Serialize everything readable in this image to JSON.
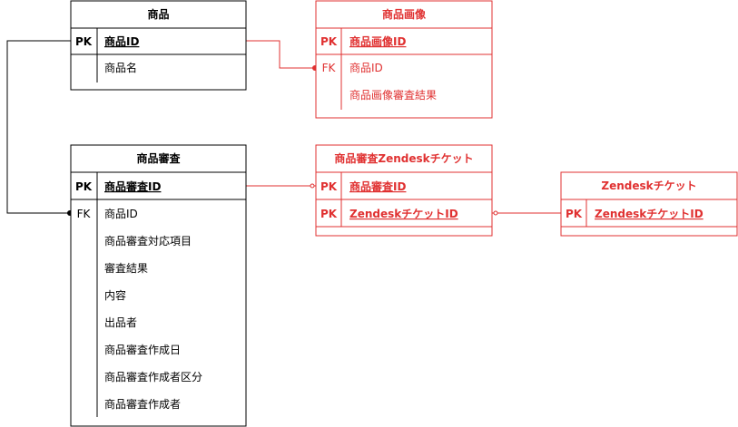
{
  "colors": {
    "black": "#000000",
    "red": "#e03131"
  },
  "entities": [
    {
      "id": "product",
      "title": "商品",
      "color": "#000000",
      "rows": [
        {
          "key": "PK",
          "name": "商品ID",
          "pk": true
        },
        {
          "key": "",
          "name": "商品名",
          "pk": false
        }
      ]
    },
    {
      "id": "product-image",
      "title": "商品画像",
      "color": "#e03131",
      "rows": [
        {
          "key": "PK",
          "name": "商品画像ID",
          "pk": true
        },
        {
          "key": "FK",
          "name": "商品ID",
          "pk": false
        },
        {
          "key": "",
          "name": "商品画像審査結果",
          "pk": false
        }
      ]
    },
    {
      "id": "product-review",
      "title": "商品審査",
      "color": "#000000",
      "rows": [
        {
          "key": "PK",
          "name": "商品審査ID",
          "pk": true
        },
        {
          "key": "FK",
          "name": "商品ID",
          "pk": false
        },
        {
          "key": "",
          "name": "商品審査対応項目",
          "pk": false
        },
        {
          "key": "",
          "name": "審査結果",
          "pk": false
        },
        {
          "key": "",
          "name": "内容",
          "pk": false
        },
        {
          "key": "",
          "name": "出品者",
          "pk": false
        },
        {
          "key": "",
          "name": "商品審査作成日",
          "pk": false
        },
        {
          "key": "",
          "name": "商品審査作成者区分",
          "pk": false
        },
        {
          "key": "",
          "name": "商品審査作成者",
          "pk": false
        }
      ]
    },
    {
      "id": "review-zendesk-ticket",
      "title": "商品審査Zendeskチケット",
      "color": "#e03131",
      "rows": [
        {
          "key": "PK",
          "name": "商品審査ID",
          "pk": true
        },
        {
          "key": "PK",
          "name": "ZendeskチケットID",
          "pk": true
        }
      ]
    },
    {
      "id": "zendesk-ticket",
      "title": "Zendeskチケット",
      "color": "#e03131",
      "rows": [
        {
          "key": "PK",
          "name": "ZendeskチケットID",
          "pk": true
        }
      ]
    }
  ]
}
